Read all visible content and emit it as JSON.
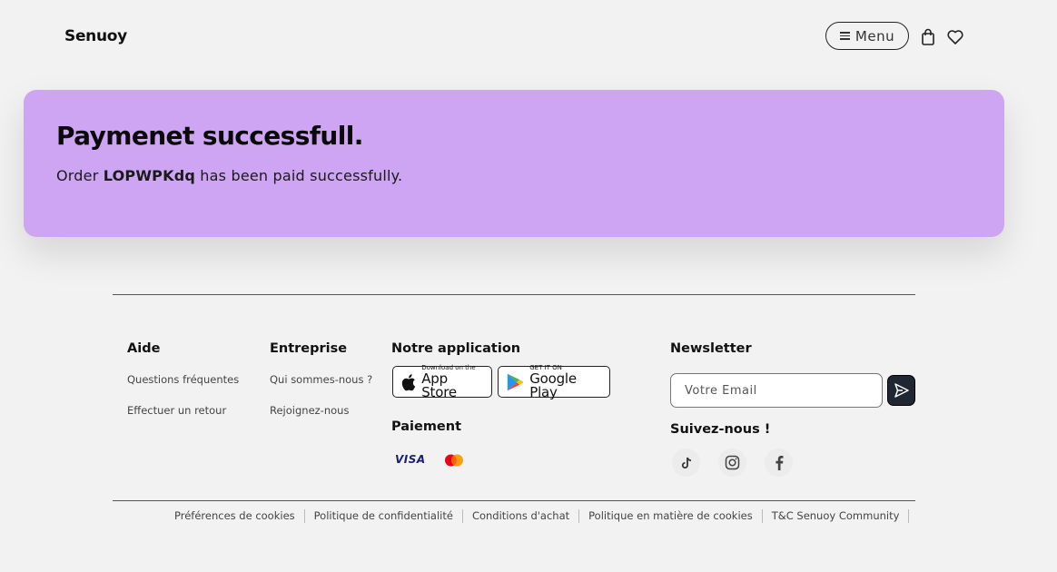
{
  "header": {
    "logo": "Senuoy",
    "menu_label": "Menu",
    "icons": [
      "bag-icon",
      "heart-icon"
    ]
  },
  "banner": {
    "title": "Paymenet successfull.",
    "order_prefix": "Order",
    "order_id": "LOPWPKdq",
    "order_suffix": "has been paid successfully."
  },
  "footer": {
    "aide": {
      "title": "Aide",
      "links": [
        "Questions fréquentes",
        "Effectuer un retour"
      ]
    },
    "entreprise": {
      "title": "Entreprise",
      "links": [
        "Qui sommes-nous ?",
        "Rejoignez-nous"
      ]
    },
    "app": {
      "title": "Notre application",
      "app_store_small": "Download on the",
      "app_store_big": "App Store",
      "google_small": "GET IT ON",
      "google_big": "Google Play"
    },
    "payment": {
      "title": "Paiement",
      "visa": "VISA",
      "methods": [
        "visa-icon",
        "mastercard-icon"
      ]
    },
    "newsletter": {
      "title": "Newsletter",
      "placeholder": "Votre Email"
    },
    "follow": {
      "title": "Suivez-nous !",
      "networks": [
        "tiktok-icon",
        "instagram-icon",
        "facebook-icon"
      ]
    },
    "legal": [
      "Préférences de cookies",
      "Politique de confidentialité",
      "Conditions d'achat",
      "Politique en matière de cookies",
      "T&C Senuoy Community"
    ]
  }
}
